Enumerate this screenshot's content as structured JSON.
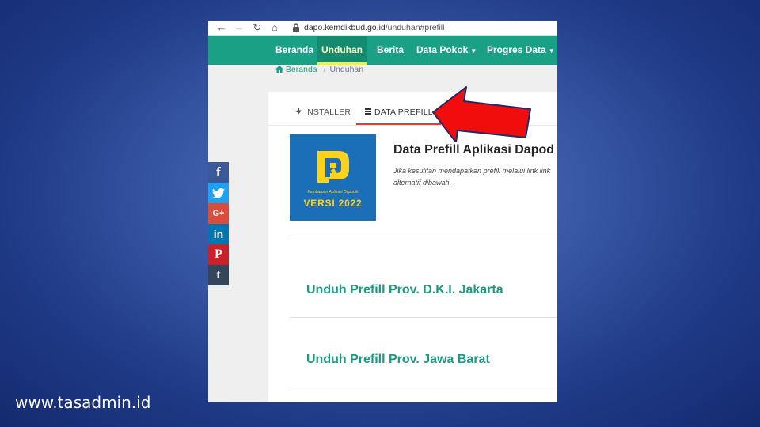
{
  "browser": {
    "url_host": "dapo.kemdikbud.go.id",
    "url_path": "/unduhan#prefill",
    "icons": [
      "back-arrow-icon",
      "forward-arrow-icon",
      "reload-icon",
      "home-icon",
      "lock-icon"
    ]
  },
  "navbar": {
    "items": [
      {
        "label": "Beranda"
      },
      {
        "label": "Unduhan",
        "active": true
      },
      {
        "label": "Berita"
      },
      {
        "label": "Data Pokok",
        "dropdown": true
      },
      {
        "label": "Progres Data",
        "dropdown": true
      }
    ],
    "bg_color": "#1aa185",
    "active_underline": "#ffeb3b"
  },
  "breadcrumb": {
    "home": "Beranda",
    "separator": "/",
    "current": "Unduhan"
  },
  "tabs": [
    {
      "label": "INSTALLER",
      "icon": "lightning-icon"
    },
    {
      "label": "DATA PREFILL",
      "icon": "database-icon",
      "active": true
    }
  ],
  "logo": {
    "subtitle": "Pembaruan Aplikasi Dapodik",
    "version": "VERSI 2022"
  },
  "content": {
    "title": "Data Prefill Aplikasi Dapod",
    "description": "Jika kesulitan mendapatkan prefill melalui link link alternatif dibawah."
  },
  "downloads": [
    {
      "label": "Unduh Prefill Prov. D.K.I. Jakarta"
    },
    {
      "label": "Unduh Prefill Prov. Jawa Barat"
    }
  ],
  "share": {
    "buttons": [
      {
        "label": "f",
        "color": "#3b5998",
        "icon": "facebook-icon"
      },
      {
        "label": "🐦",
        "color": "#1da1f2",
        "icon": "twitter-icon"
      },
      {
        "label": "G+",
        "color": "#dd4b39",
        "icon": "google-plus-icon"
      },
      {
        "label": "in",
        "color": "#0077b5",
        "icon": "linkedin-icon"
      },
      {
        "label": "P",
        "color": "#cb2027",
        "icon": "pinterest-icon"
      },
      {
        "label": "t",
        "color": "#35465c",
        "icon": "tumblr-icon"
      }
    ]
  },
  "watermark": "www.tasadmin.id",
  "annotation": {
    "icon": "red-arrow-icon",
    "color": "#f20d0d"
  }
}
